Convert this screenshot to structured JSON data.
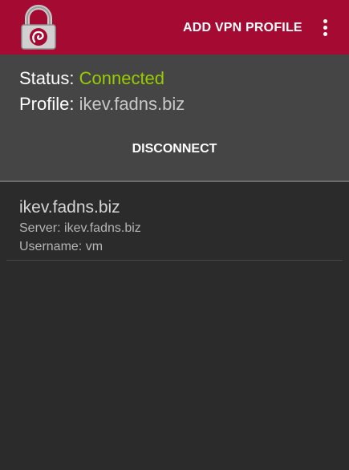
{
  "app_bar": {
    "logo_icon": "padlock-icon",
    "add_profile_label": "ADD VPN PROFILE",
    "overflow_icon": "more-vert-icon",
    "background_color": "#a50b32"
  },
  "status_panel": {
    "status_label": "Status:",
    "status_value": "Connected",
    "status_color": "#99cc00",
    "profile_label": "Profile:",
    "profile_value": "ikev.fadns.biz",
    "disconnect_label": "DISCONNECT"
  },
  "profiles": [
    {
      "name": "ikev.fadns.biz",
      "server": "Server: ikev.fadns.biz",
      "username": "Username: vm"
    }
  ]
}
